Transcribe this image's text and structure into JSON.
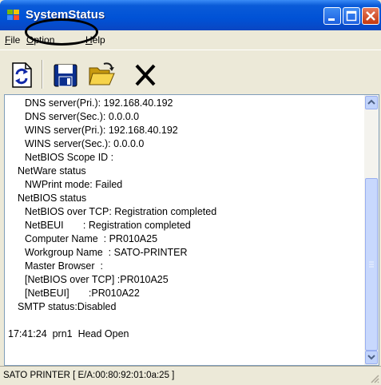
{
  "window": {
    "title": "SystemStatus"
  },
  "menu": {
    "items": [
      {
        "prefix": "",
        "accel": "F",
        "rest": "ile"
      },
      {
        "prefix": "",
        "accel": "O",
        "rest": "ption"
      },
      {
        "prefix": "",
        "accel": "H",
        "rest": "elp"
      }
    ]
  },
  "toolbar": {
    "icons": [
      "refresh-icon",
      "save-icon",
      "open-folder-icon",
      "delete-icon"
    ]
  },
  "content": {
    "lines": [
      "DNS server(Pri.): 192.168.40.192",
      "DNS server(Sec.): 0.0.0.0",
      "WINS server(Pri.): 192.168.40.192",
      "WINS server(Sec.): 0.0.0.0",
      "NetBIOS Scope ID :",
      "NetWare status",
      "NWPrint mode: Failed",
      "NetBIOS status",
      "NetBIOS over TCP: Registration completed",
      "NetBEUI       : Registration completed",
      "Computer Name  : PR010A25",
      "Workgroup Name  : SATO-PRINTER",
      "Master Browser  :",
      "[NetBIOS over TCP] :PR010A25",
      "[NetBEUI]       :PR010A22",
      "SMTP status:Disabled",
      "",
      "17:41:24  prn1  Head Open"
    ]
  },
  "status": {
    "text": "SATO PRINTER [ E/A:00:80:92:01:0a:25 ]"
  },
  "colors": {
    "titlebar": "#0052d6",
    "close": "#c4380f",
    "face": "#ece9d8"
  }
}
